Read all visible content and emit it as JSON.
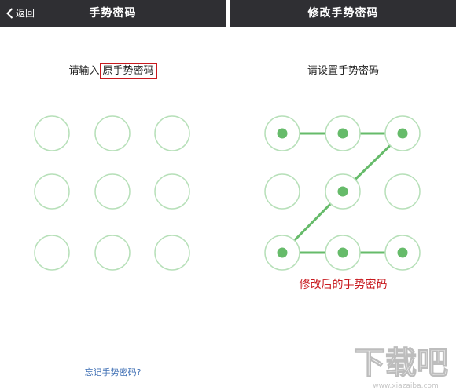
{
  "left": {
    "back_label": "返回",
    "title": "手势密码",
    "prompt_prefix": "请输入",
    "prompt_highlight": "原手势密码",
    "forgot_label": "忘记手势密码?"
  },
  "right": {
    "title": "修改手势密码",
    "prompt": "请设置手势密码",
    "caption": "修改后的手势密码",
    "selected_dots": [
      1,
      2,
      3,
      5,
      7,
      8,
      9
    ],
    "path_order": [
      1,
      2,
      3,
      5,
      7,
      8,
      9
    ]
  },
  "colors": {
    "topbar": "#2f2f33",
    "pattern_green": "#66bb6a",
    "circle_outline": "#b7e0b9",
    "highlight_red": "#c8191e",
    "link_blue": "#3f6fb4"
  },
  "watermark": {
    "text": "下载吧",
    "url": "www.xiazaiba.com"
  }
}
